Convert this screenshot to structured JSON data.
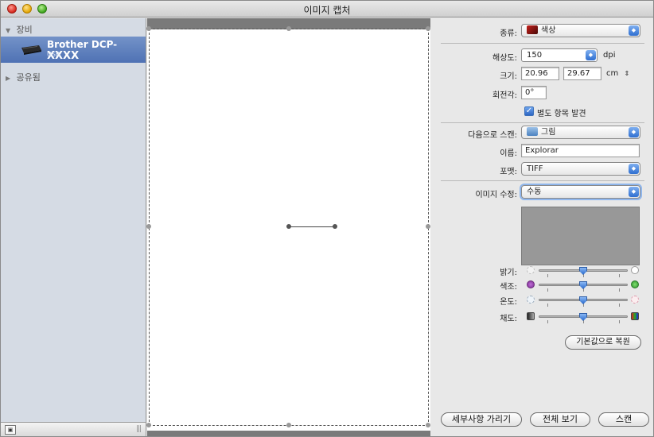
{
  "window": {
    "title": "이미지 캡처"
  },
  "sidebar": {
    "devices_header": "장비",
    "device": {
      "name": "Brother DCP-",
      "name_suffix": "XXXX",
      "sub": "USB"
    },
    "shared_header": "공유됨"
  },
  "settings": {
    "kind": {
      "label": "종류:",
      "value": "색상"
    },
    "resolution": {
      "label": "해상도:",
      "value": "150",
      "unit": "dpi"
    },
    "size": {
      "label": "크기:",
      "width": "20.96",
      "height": "29.67",
      "unit": "cm"
    },
    "rotation": {
      "label": "회전각:",
      "value": "0°"
    },
    "detect_separate": {
      "label": "별도 항목 발견",
      "checked": true
    },
    "scan_to": {
      "label": "다음으로 스캔:",
      "value": "그림"
    },
    "name": {
      "label": "이름:",
      "value": "Explorar"
    },
    "format": {
      "label": "포맷:",
      "value": "TIFF"
    },
    "image_correction": {
      "label": "이미지 수정:",
      "value": "수동"
    },
    "sliders": [
      {
        "label": "밝기:",
        "icon_left": "sun-dim-icon",
        "icon_right": "sun-bright-icon",
        "level": 0.5
      },
      {
        "label": "색조:",
        "icon_left": "purple-circle-icon",
        "icon_right": "green-circle-icon",
        "level": 0.5
      },
      {
        "label": "온도:",
        "icon_left": "cool-sun-icon",
        "icon_right": "warm-sun-icon",
        "level": 0.5
      },
      {
        "label": "채도:",
        "icon_left": "grayscale-icon",
        "icon_right": "color-icon",
        "level": 0.5
      }
    ],
    "restore_defaults": "기본값으로 복원"
  },
  "buttons": {
    "hide_details": "세부사항 가리기",
    "overview": "전체 보기",
    "scan": "스캔"
  },
  "colors": {
    "selection": "#5577bb",
    "accent": "#2f6fd0",
    "preview_bg": "#7a7a7a"
  }
}
